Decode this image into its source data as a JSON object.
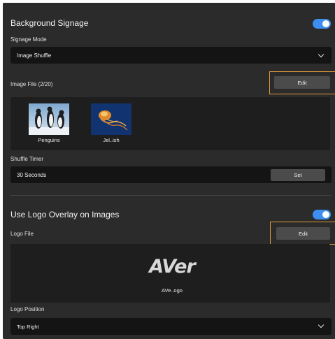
{
  "background_signage": {
    "title": "Background Signage",
    "enabled": true,
    "signage_mode_label": "Signage Mode",
    "signage_mode_value": "Image Shuffle",
    "image_file_label": "Image File (2/20)",
    "edit_label": "Edit",
    "images": [
      {
        "name": "Penguins",
        "icon": "penguins-thumbnail"
      },
      {
        "name": "Jel..ish",
        "icon": "jellyfish-thumbnail"
      }
    ],
    "shuffle_timer_label": "Shuffle Timer",
    "shuffle_timer_value": "30 Seconds",
    "set_label": "Set"
  },
  "logo_overlay": {
    "title": "Use Logo Overlay on Images",
    "enabled": true,
    "logo_file_label": "Logo File",
    "edit_label": "Edit",
    "logo_text": "AVer",
    "logo_file_name": "AVe..ogo",
    "logo_position_label": "Logo Position",
    "logo_position_value": "Top Right"
  },
  "colors": {
    "accent": "#3d8ef0",
    "highlight": "#e09a3a",
    "panel_bg": "#2b2b2b"
  }
}
